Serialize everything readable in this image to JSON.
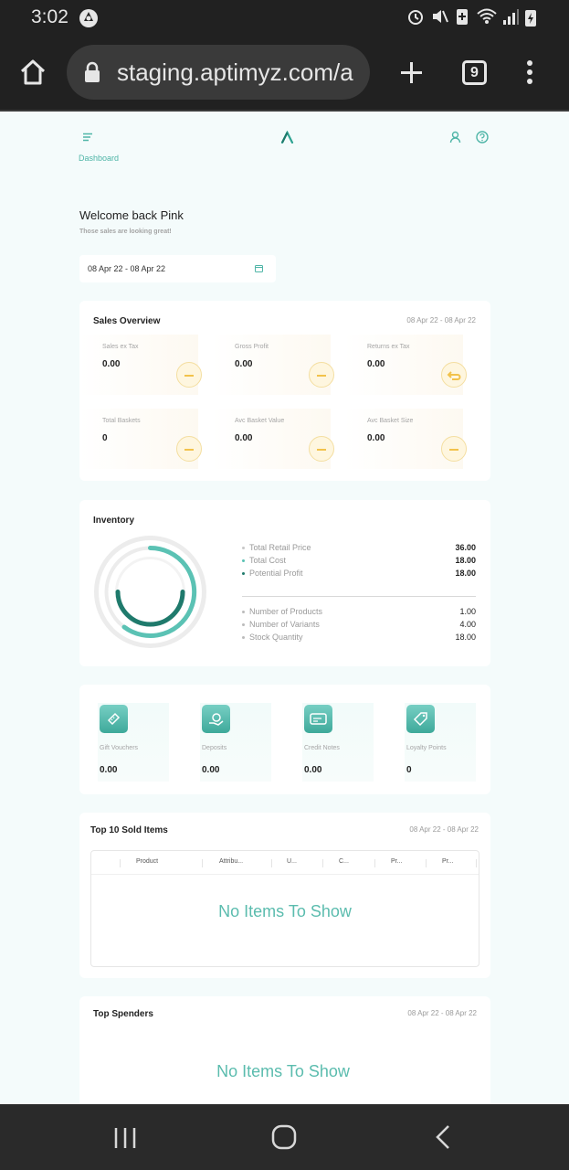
{
  "status_bar": {
    "time": "3:02"
  },
  "browser": {
    "url": "staging.aptimyz.com/a",
    "tab_count": "9"
  },
  "header": {
    "breadcrumb": "Dashboard"
  },
  "welcome": {
    "title": "Welcome back Pink",
    "subtitle": "Those sales are looking great!"
  },
  "date_picker": {
    "value": "08 Apr 22 - 08 Apr 22"
  },
  "sales_overview": {
    "title": "Sales Overview",
    "date": "08 Apr 22 - 08 Apr 22",
    "tiles": [
      {
        "label": "Sales ex Tax",
        "value": "0.00"
      },
      {
        "label": "Gross Profit",
        "value": "0.00"
      },
      {
        "label": "Returns ex Tax",
        "value": "0.00"
      },
      {
        "label": "Total Baskets",
        "value": "0"
      },
      {
        "label": "Avc Basket Value",
        "value": "0.00"
      },
      {
        "label": "Avc Basket Size",
        "value": "0.00"
      }
    ]
  },
  "inventory": {
    "title": "Inventory",
    "stats_top": [
      {
        "label": "Total Retail Price",
        "value": "36.00"
      },
      {
        "label": "Total Cost",
        "value": "18.00"
      },
      {
        "label": "Potential Profit",
        "value": "18.00"
      }
    ],
    "stats_bottom": [
      {
        "label": "Number of Products",
        "value": "1.00"
      },
      {
        "label": "Number of Variants",
        "value": "4.00"
      },
      {
        "label": "Stock Quantity",
        "value": "18.00"
      }
    ],
    "ring_colors": [
      "#5bc2b4",
      "#1f7a6c",
      "#ececec"
    ]
  },
  "vouchers": [
    {
      "label": "Gift Vouchers",
      "value": "0.00",
      "icon": "ticket-icon"
    },
    {
      "label": "Deposits",
      "value": "0.00",
      "icon": "money-hand-icon"
    },
    {
      "label": "Credit Notes",
      "value": "0.00",
      "icon": "credit-card-icon"
    },
    {
      "label": "Loyalty Points",
      "value": "0",
      "icon": "tag-icon"
    }
  ],
  "top_sold": {
    "title": "Top 10 Sold Items",
    "date": "08 Apr 22 - 08 Apr 22",
    "columns": [
      "Product",
      "Attribu...",
      "U...",
      "C...",
      "Pr...",
      "Pr..."
    ],
    "empty_text": "No Items To Show"
  },
  "top_spenders": {
    "title": "Top Spenders",
    "date": "08 Apr 22 - 08 Apr 22",
    "empty_text": "No Items To Show"
  },
  "colors": {
    "accent": "#4fb5a7",
    "accent_dark": "#1f7a6c",
    "yellow": "#f2c24b"
  }
}
